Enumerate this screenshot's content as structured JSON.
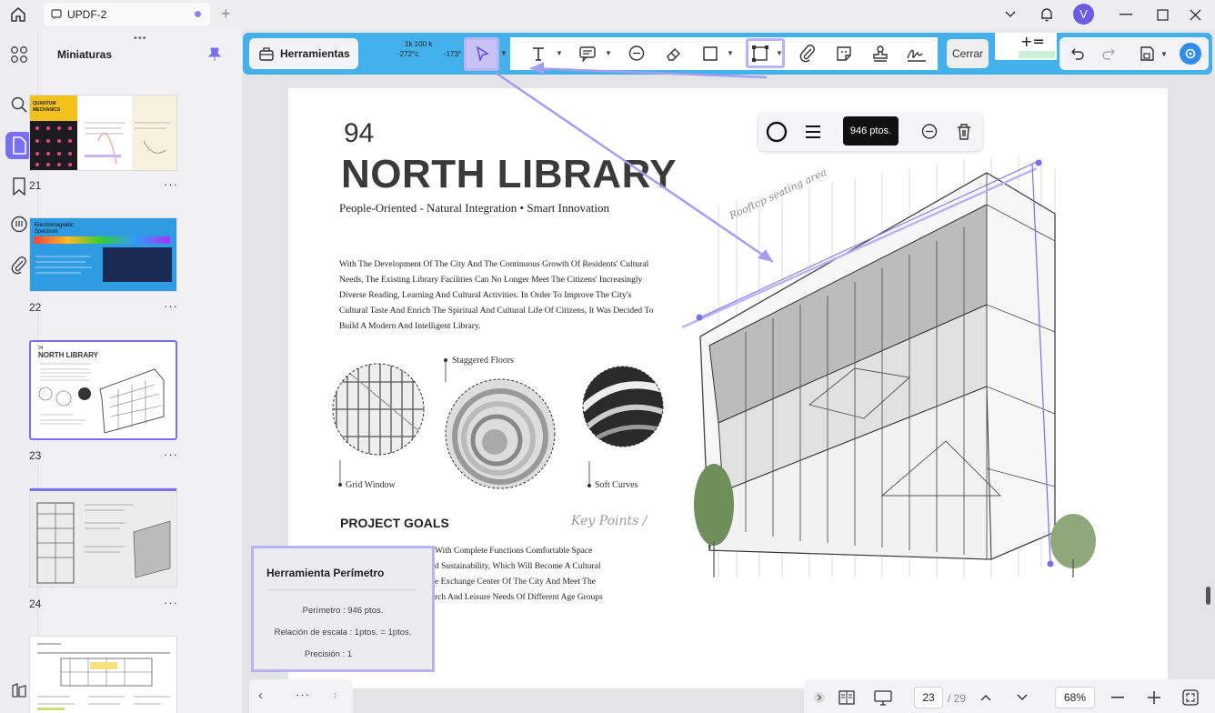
{
  "tab": {
    "title": "UPDF-2"
  },
  "avatar": {
    "initial": "V"
  },
  "thumbnails": {
    "title": "Miniaturas",
    "items": [
      {
        "num": "21",
        "label": "QUANTUM MECHANICS"
      },
      {
        "num": "22",
        "label": "Electromagnetic Spectrum"
      },
      {
        "num": "23",
        "label": "NORTH LIBRARY"
      },
      {
        "num": "24",
        "label": ""
      },
      {
        "num": "",
        "label": ""
      }
    ]
  },
  "toolbar": {
    "tools_label": "Herramientas",
    "close_label": "Cerrar",
    "ruler_a": "1k 100 k",
    "ruler_b": "-272°c",
    "ruler_c": "-173°",
    "accent": "#42b1ec"
  },
  "page": {
    "number": "94",
    "title": "NORTH LIBRARY",
    "subtitle": "People-Oriented - Natural Integration • Smart Innovation",
    "body": "With The Development Of The City And The Continuous Growth Of Residents' Cultural Needs, The Existing Library Facilities Can No Longer Meet The Citizens' Increasingly Diverse Reading, Learning And Cultural Activities. In Order To Improve The City's Cultural Taste And Enrich The Spiritual And Cultural Life Of Citizens, It Was Decided To Build A Modern And Intelligent Library.",
    "staggered": "Staggered Floors",
    "grid_window": "Grid Window",
    "soft_curves": "Soft Curves",
    "goals_title": "PROJECT GOALS",
    "key_points": "Key Points /",
    "rooftop": "Rooftop seating area",
    "goals_body": "With Complete Functions Comfortable Space\nd Sustainability, Which Will Become A Cultural\ne Exchange Center Of The City And Meet The\nrch And Leisure Needs Of Different Age Groups"
  },
  "tooltip": {
    "text": "946 ptos."
  },
  "perimeter_panel": {
    "title": "Herramienta Perímetro",
    "perimeter": "Perímetro : 946 ptos.",
    "scale": "Relación de escala : 1ptos. = 1ptos.",
    "precision": "Precisión : 1"
  },
  "navigation": {
    "current_page": "23",
    "total_pages": "/ 29",
    "zoom": "68%"
  },
  "colors": {
    "accent": "#7a6ff0",
    "highlight": "#b9b3f1"
  }
}
